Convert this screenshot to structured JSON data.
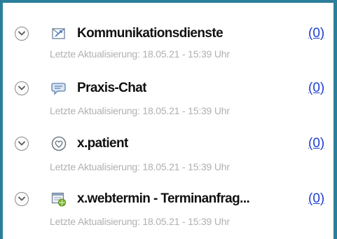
{
  "items": [
    {
      "icon": "communication-icon",
      "title": "Kommunikationsdienste",
      "count": "(0)",
      "updated": "Letzte Aktualisierung: 18.05.21 - 15:39 Uhr"
    },
    {
      "icon": "chat-icon",
      "title": "Praxis-Chat",
      "count": "(0)",
      "updated": "Letzte Aktualisierung: 18.05.21 - 15:39 Uhr"
    },
    {
      "icon": "heart-shield-icon",
      "title": "x.patient",
      "count": "(0)",
      "updated": "Letzte Aktualisierung: 18.05.21 - 15:39 Uhr"
    },
    {
      "icon": "web-calendar-icon",
      "title": "x.webtermin - Terminanfrag...",
      "count": "(0)",
      "updated": "Letzte Aktualisierung: 18.05.21 - 15:39 Uhr"
    }
  ],
  "colors": {
    "frame": "#2c7f9a",
    "link": "#1e3fcf",
    "muted": "#b0b0b0"
  }
}
